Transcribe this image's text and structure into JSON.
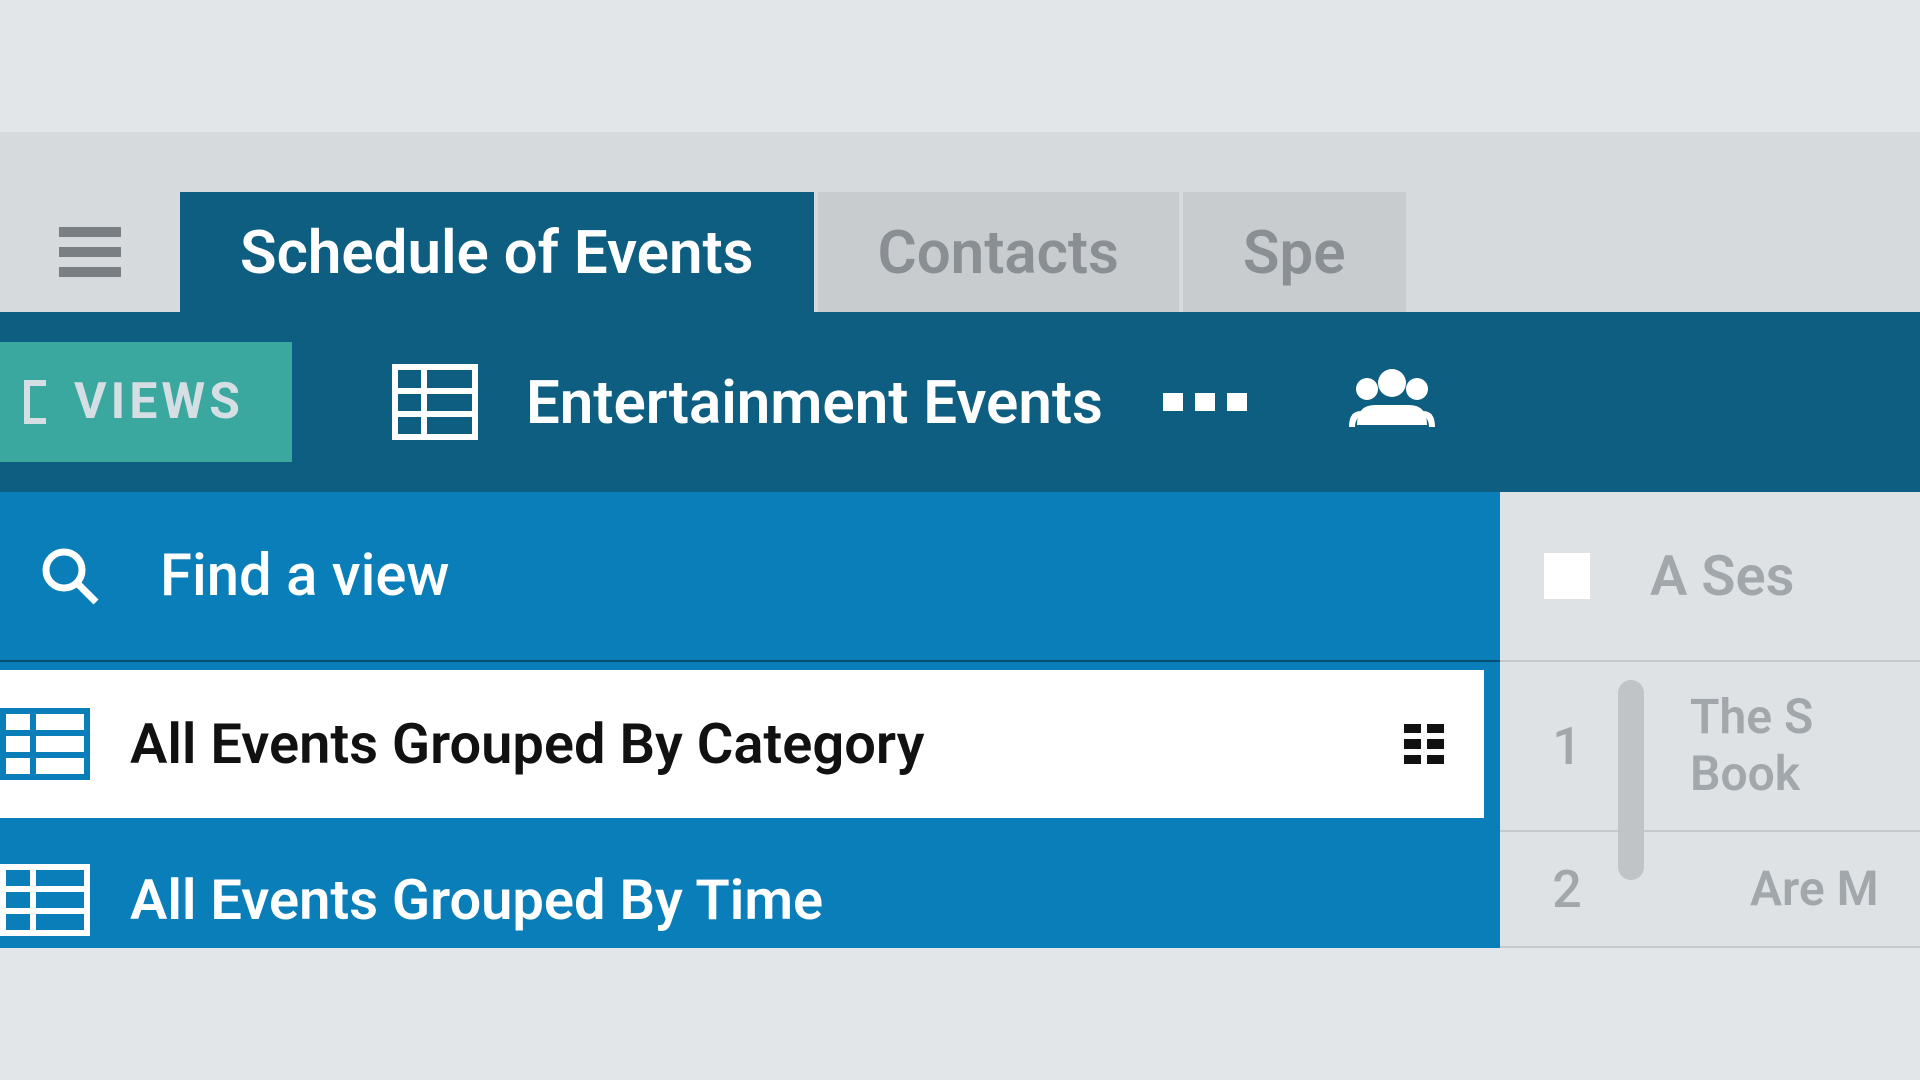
{
  "tabs": {
    "active": "Schedule of Events",
    "inactive1": "Contacts",
    "inactive2": "Spe"
  },
  "toolbar": {
    "views_label": "VIEWS",
    "current_view": "Entertainment Events"
  },
  "views_panel": {
    "search_placeholder": "Find a view",
    "items": [
      {
        "label": "All Events Grouped By Category",
        "selected": true
      },
      {
        "label": "All Events Grouped By Time",
        "selected": false
      }
    ]
  },
  "data_area": {
    "header_text": "A Ses",
    "rows": [
      {
        "num": "1",
        "lines": [
          "The S",
          "Book"
        ]
      },
      {
        "num": "2",
        "lines": [
          "Are M"
        ]
      }
    ]
  }
}
